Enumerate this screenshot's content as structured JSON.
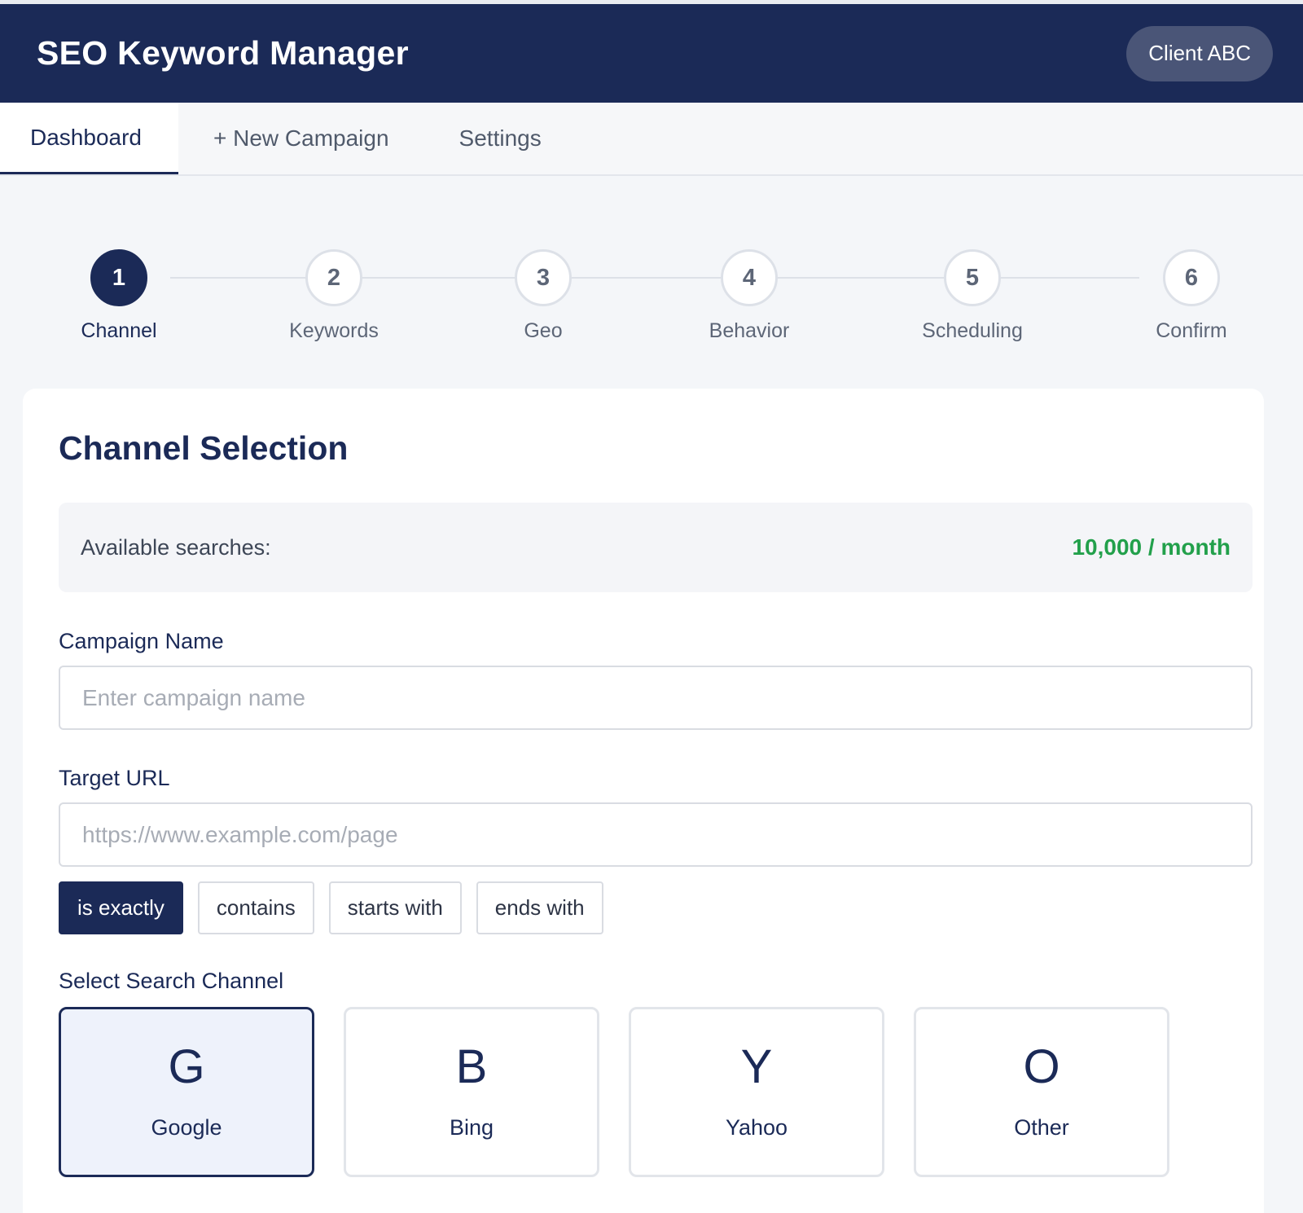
{
  "header": {
    "app_title": "SEO Keyword Manager",
    "client_label": "Client ABC"
  },
  "nav": {
    "tabs": [
      {
        "label": "Dashboard",
        "active": true
      },
      {
        "label": "+ New Campaign",
        "active": false
      },
      {
        "label": "Settings",
        "active": false
      }
    ]
  },
  "stepper": {
    "steps": [
      {
        "number": "1",
        "label": "Channel",
        "active": true
      },
      {
        "number": "2",
        "label": "Keywords",
        "active": false
      },
      {
        "number": "3",
        "label": "Geo",
        "active": false
      },
      {
        "number": "4",
        "label": "Behavior",
        "active": false
      },
      {
        "number": "5",
        "label": "Scheduling",
        "active": false
      },
      {
        "number": "6",
        "label": "Confirm",
        "active": false
      }
    ]
  },
  "card": {
    "title": "Channel Selection",
    "available": {
      "label": "Available searches:",
      "value": "10,000 / month"
    },
    "campaign_name": {
      "label": "Campaign Name",
      "value": "",
      "placeholder": "Enter campaign name"
    },
    "target_url": {
      "label": "Target URL",
      "value": "",
      "placeholder": "https://www.example.com/page"
    },
    "match_types": [
      {
        "label": "is exactly",
        "selected": true
      },
      {
        "label": "contains",
        "selected": false
      },
      {
        "label": "starts with",
        "selected": false
      },
      {
        "label": "ends with",
        "selected": false
      }
    ],
    "channel_label": "Select Search Channel",
    "channels": [
      {
        "letter": "G",
        "name": "Google",
        "selected": true
      },
      {
        "letter": "B",
        "name": "Bing",
        "selected": false
      },
      {
        "letter": "Y",
        "name": "Yahoo",
        "selected": false
      },
      {
        "letter": "O",
        "name": "Other",
        "selected": false
      }
    ]
  },
  "colors": {
    "primary": "#1b2a57",
    "success": "#22a04b",
    "background": "#f4f6f9"
  }
}
